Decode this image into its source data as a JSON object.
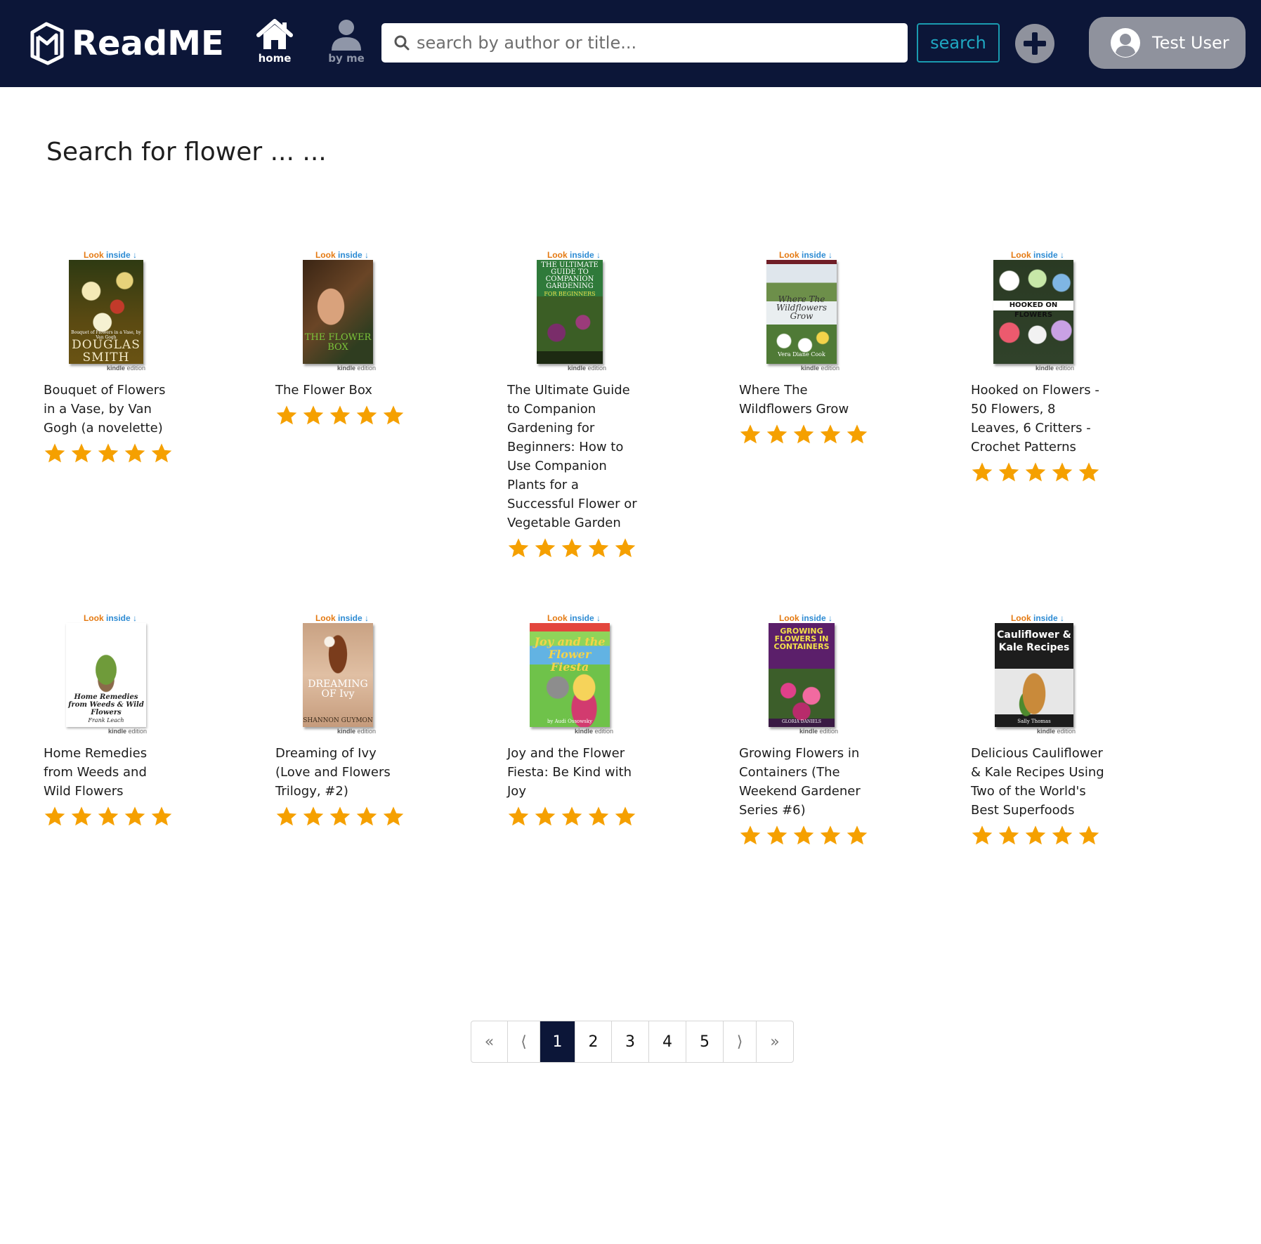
{
  "app": {
    "brand": "ReadME",
    "nav_home": "home",
    "nav_byme": "by me",
    "search_placeholder": "search by author or title...",
    "search_button": "search",
    "user_name": "Test User",
    "colors": {
      "header_bg": "#0c1638",
      "accent": "#1fa8c2",
      "star": "#f5a000",
      "user_pill": "#8f929d"
    }
  },
  "page": {
    "heading": "Search for flower ... ..."
  },
  "badges": {
    "look": "Look",
    "inside": "inside",
    "kindle": "kindle",
    "edition": "edition"
  },
  "books": [
    {
      "title": "Bouquet of Flowers in a Vase, by Van Gogh (a novelette)",
      "rating": 5,
      "cover_text": "DOUGLAS SMITH",
      "cover_subtext": "Bouquet of Flowers in a Vase, by Van Gogh"
    },
    {
      "title": "The Flower Box",
      "rating": 5,
      "cover_text": "THE FLOWER BOX",
      "cover_subtext": ""
    },
    {
      "title": "The Ultimate Guide to Companion Gardening for Beginners: How to Use Companion Plants for a Successful Flower or Vegetable Garden",
      "rating": 5,
      "cover_text": "THE ULTIMATE GUIDE TO COMPANION GARDENING",
      "cover_subtext": "FOR BEGINNERS"
    },
    {
      "title": "Where The Wildflowers Grow",
      "rating": 5,
      "cover_text": "Where The Wildflowers Grow",
      "cover_subtext": "Vera Diane Cook"
    },
    {
      "title": "Hooked on Flowers - 50 Flowers, 8 Leaves, 6 Critters - Crochet Patterns",
      "rating": 5,
      "cover_text": "HOOKED ON FLOWERS",
      "cover_subtext": ""
    },
    {
      "title": "Home Remedies from Weeds and Wild Flowers",
      "rating": 5,
      "cover_text": "Home Remedies from Weeds & Wild Flowers",
      "cover_subtext": "Frank Leach"
    },
    {
      "title": "Dreaming of Ivy (Love and Flowers Trilogy, #2)",
      "rating": 5,
      "cover_text": "DREAMING OF Ivy",
      "cover_subtext": "SHANNON GUYMON"
    },
    {
      "title": "Joy and the Flower Fiesta: Be Kind with Joy",
      "rating": 5,
      "cover_text": "Joy and the Flower Fiesta",
      "cover_subtext": "by Audi Ossowsky"
    },
    {
      "title": "Growing Flowers in Containers (The Weekend Gardener Series #6)",
      "rating": 5,
      "cover_text": "GROWING FLOWERS IN CONTAINERS",
      "cover_subtext": "GLORIA DANIELS"
    },
    {
      "title": "Delicious Cauliflower & Kale Recipes Using Two of the World's Best Superfoods",
      "rating": 5,
      "cover_text": "Cauliflower & Kale Recipes",
      "cover_subtext": "Sally Thomas"
    }
  ],
  "pagination": {
    "first": "«",
    "prev": "⟨",
    "pages": [
      "1",
      "2",
      "3",
      "4",
      "5"
    ],
    "current": "1",
    "next": "⟩",
    "last": "»"
  }
}
